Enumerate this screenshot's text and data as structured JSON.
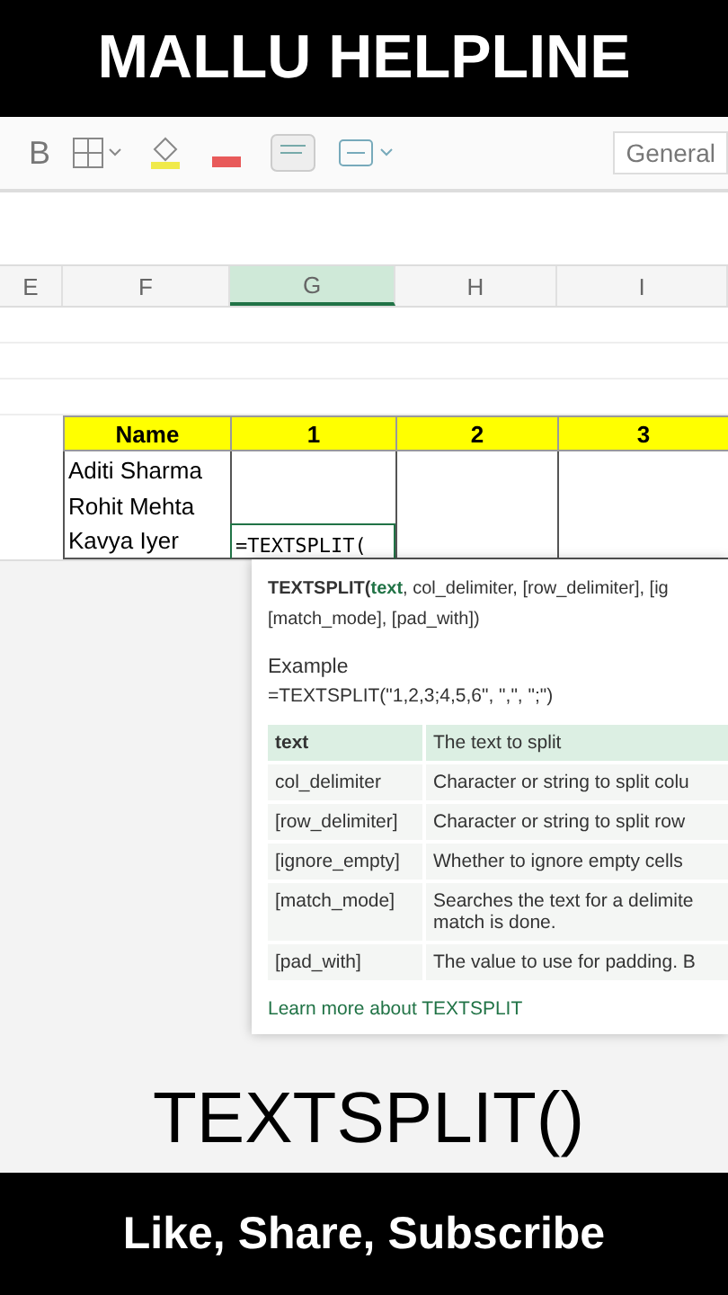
{
  "banner_top": {
    "title": "MALLU HELPLINE"
  },
  "toolbar": {
    "bold": "B",
    "number_format": "General"
  },
  "columns": [
    {
      "label": "E",
      "selected": false
    },
    {
      "label": "F",
      "selected": false
    },
    {
      "label": "G",
      "selected": true
    },
    {
      "label": "H",
      "selected": false
    },
    {
      "label": "I",
      "selected": false
    }
  ],
  "table": {
    "header": [
      "Name",
      "1",
      "2",
      "3"
    ],
    "rows": [
      [
        "Aditi Sharma",
        "",
        "",
        ""
      ],
      [
        "Rohit Mehta",
        "",
        "",
        ""
      ],
      [
        "Kavya Iyer",
        "=TEXTSPLIT(",
        "",
        ""
      ]
    ]
  },
  "tooltip": {
    "function": "TEXTSPLIT(",
    "current_arg": "text",
    "line1_rest": ", col_delimiter, [row_delimiter], [ig",
    "line2": "[match_mode], [pad_with])",
    "example_label": "Example",
    "example": "=TEXTSPLIT(\"1,2,3;4,5,6\", \",\", \";\")",
    "args": [
      {
        "name": "text",
        "description": "The text to split",
        "selected": true
      },
      {
        "name": "col_delimiter",
        "description": "Character or string to split colu",
        "selected": false
      },
      {
        "name": "[row_delimiter]",
        "description": "Character or string to split row",
        "selected": false
      },
      {
        "name": "[ignore_empty]",
        "description": "Whether to ignore empty cells",
        "selected": false
      },
      {
        "name": "[match_mode]",
        "description": "Searches the text for a delimite",
        "description_2": "match is done.",
        "selected": false
      },
      {
        "name": "[pad_with]",
        "description": "The value to use for padding. B",
        "selected": false
      }
    ],
    "link": "Learn more about TEXTSPLIT"
  },
  "caption": "TEXTSPLIT()",
  "banner_bottom": {
    "title": "Like, Share, Subscribe"
  }
}
